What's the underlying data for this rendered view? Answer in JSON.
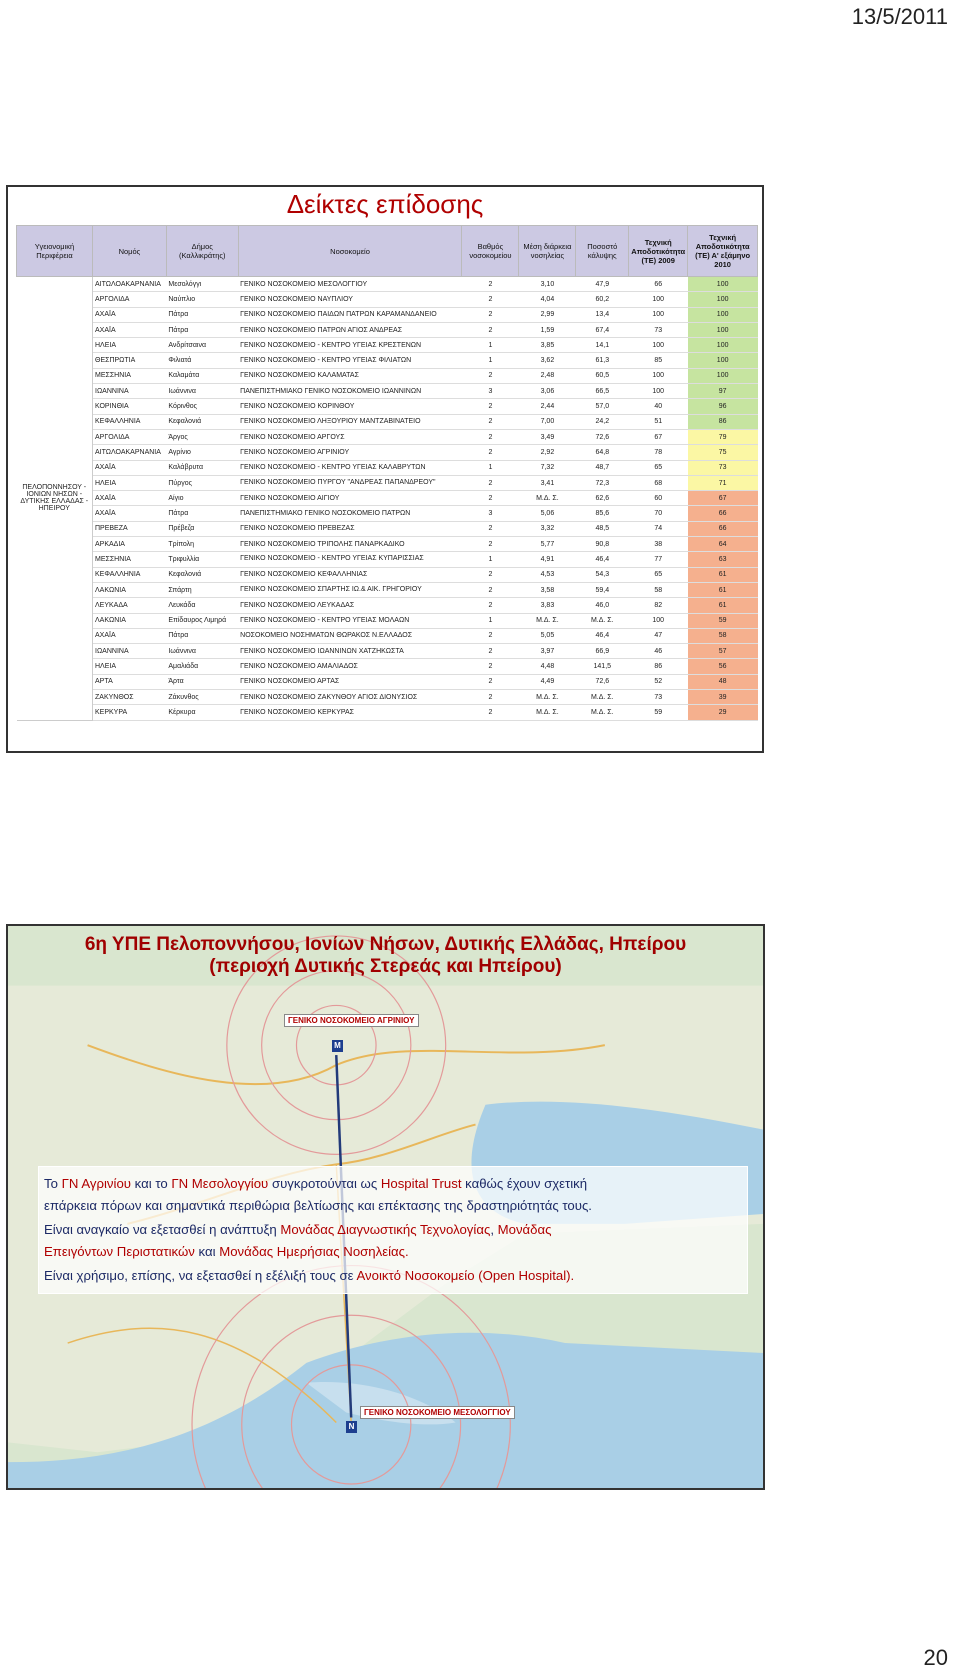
{
  "page": {
    "date": "13/5/2011",
    "page_number": "20"
  },
  "slide1": {
    "title": "Δείκτες επίδοσης",
    "headers": {
      "region": "Υγειονομική Περιφέρεια",
      "prefecture": "Νομός",
      "municipality": "Δήμος (Καλλικράτης)",
      "hospital": "Νοσοκομείο",
      "grade": "Βαθμός νοσοκομείου",
      "avg_stay": "Μέση διάρκεια νοσηλείας",
      "coverage": "Ποσοστό κάλυψης",
      "tech_2009": "Τεχνική Αποδοτικότητα (ΤΕ) 2009",
      "tech_2010": "Τεχνική Αποδοτικότητα (ΤΕ) Α' εξάμηνο 2010"
    },
    "region_name": "ΠΕΛΟΠΟΝΝΗΣΟΥ - ΙΟΝΙΩΝ ΝΗΣΩΝ - ΔΥΤΙΚΗΣ ΕΛΛΑΔΑΣ - ΗΠΕΙΡΟΥ",
    "rows": [
      {
        "prefecture": "ΑΙΤΩΛΟΑΚΑΡΝΑΝΙΑ",
        "municipality": "Μεσολόγγι",
        "hospital": "ΓΕΝΙΚΟ ΝΟΣΟΚΟΜΕΙΟ ΜΕΣΟΛΟΓΓΙΟΥ",
        "grade": "2",
        "stay": "3,10",
        "coverage": "47,9",
        "te2009": "66",
        "te2010": "100",
        "color": "g"
      },
      {
        "prefecture": "ΑΡΓΟΛΙΔΑ",
        "municipality": "Ναύπλιο",
        "hospital": "ΓΕΝΙΚΟ ΝΟΣΟΚΟΜΕΙΟ ΝΑΥΠΛΙΟΥ",
        "grade": "2",
        "stay": "4,04",
        "coverage": "60,2",
        "te2009": "100",
        "te2010": "100",
        "color": "g"
      },
      {
        "prefecture": "ΑΧΑΪΑ",
        "municipality": "Πάτρα",
        "hospital": "ΓΕΝΙΚΟ ΝΟΣΟΚΟΜΕΙΟ ΠΑΙΔΩΝ ΠΑΤΡΩΝ ΚΑΡΑΜΑΝΔΑΝΕΙΟ",
        "grade": "2",
        "stay": "2,99",
        "coverage": "13,4",
        "te2009": "100",
        "te2010": "100",
        "color": "g"
      },
      {
        "prefecture": "ΑΧΑΪΑ",
        "municipality": "Πάτρα",
        "hospital": "ΓΕΝΙΚΟ ΝΟΣΟΚΟΜΕΙΟ ΠΑΤΡΩΝ ΑΓΙΟΣ ΑΝΔΡΕΑΣ",
        "grade": "2",
        "stay": "1,59",
        "coverage": "67,4",
        "te2009": "73",
        "te2010": "100",
        "color": "g"
      },
      {
        "prefecture": "ΗΛΕΙΑ",
        "municipality": "Ανδρίτσαινα",
        "hospital": "ΓΕΝΙΚΟ ΝΟΣΟΚΟΜΕΙΟ - ΚΕΝΤΡΟ ΥΓΕΙΑΣ ΚΡΕΣΤΕΝΩΝ",
        "grade": "1",
        "stay": "3,85",
        "coverage": "14,1",
        "te2009": "100",
        "te2010": "100",
        "color": "g"
      },
      {
        "prefecture": "ΘΕΣΠΡΩΤΙΑ",
        "municipality": "Φιλιατά",
        "hospital": "ΓΕΝΙΚΟ ΝΟΣΟΚΟΜΕΙΟ - ΚΕΝΤΡΟ ΥΓΕΙΑΣ ΦΙΛΙΑΤΩΝ",
        "grade": "1",
        "stay": "3,62",
        "coverage": "61,3",
        "te2009": "85",
        "te2010": "100",
        "color": "g"
      },
      {
        "prefecture": "ΜΕΣΣΗΝΙΑ",
        "municipality": "Καλαμάτα",
        "hospital": "ΓΕΝΙΚΟ ΝΟΣΟΚΟΜΕΙΟ ΚΑΛΑΜΑΤΑΣ",
        "grade": "2",
        "stay": "2,48",
        "coverage": "60,5",
        "te2009": "100",
        "te2010": "100",
        "color": "g"
      },
      {
        "prefecture": "ΙΩΑΝΝΙΝΑ",
        "municipality": "Ιωάννινα",
        "hospital": "ΠΑΝΕΠΙΣΤΗΜΙΑΚΟ ΓΕΝΙΚΟ ΝΟΣΟΚΟΜΕΙΟ ΙΩΑΝΝΙΝΩΝ",
        "grade": "3",
        "stay": "3,06",
        "coverage": "66,5",
        "te2009": "100",
        "te2010": "97",
        "color": "g"
      },
      {
        "prefecture": "ΚΟΡΙΝΘΙΑ",
        "municipality": "Κόρινθος",
        "hospital": "ΓΕΝΙΚΟ ΝΟΣΟΚΟΜΕΙΟ ΚΟΡΙΝΘΟΥ",
        "grade": "2",
        "stay": "2,44",
        "coverage": "57,0",
        "te2009": "40",
        "te2010": "96",
        "color": "g"
      },
      {
        "prefecture": "ΚΕΦΑΛΛΗΝΙΑ",
        "municipality": "Κεφαλονιά",
        "hospital": "ΓΕΝΙΚΟ ΝΟΣΟΚΟΜΕΙΟ ΛΗΞΟΥΡΙΟΥ ΜΑΝΤΖΑΒΙΝΑΤΕΙΟ",
        "grade": "2",
        "stay": "7,00",
        "coverage": "24,2",
        "te2009": "51",
        "te2010": "86",
        "color": "g"
      },
      {
        "prefecture": "ΑΡΓΟΛΙΔΑ",
        "municipality": "Άργος",
        "hospital": "ΓΕΝΙΚΟ ΝΟΣΟΚΟΜΕΙΟ ΑΡΓΟΥΣ",
        "grade": "2",
        "stay": "3,49",
        "coverage": "72,6",
        "te2009": "67",
        "te2010": "79",
        "color": "y"
      },
      {
        "prefecture": "ΑΙΤΩΛΟΑΚΑΡΝΑΝΙΑ",
        "municipality": "Αγρίνιο",
        "hospital": "ΓΕΝΙΚΟ ΝΟΣΟΚΟΜΕΙΟ ΑΓΡΙΝΙΟΥ",
        "grade": "2",
        "stay": "2,92",
        "coverage": "64,8",
        "te2009": "78",
        "te2010": "75",
        "color": "y"
      },
      {
        "prefecture": "ΑΧΑΪΑ",
        "municipality": "Καλάβρυτα",
        "hospital": "ΓΕΝΙΚΟ ΝΟΣΟΚΟΜΕΙΟ - ΚΕΝΤΡΟ ΥΓΕΙΑΣ ΚΑΛΑΒΡΥΤΩΝ",
        "grade": "1",
        "stay": "7,32",
        "coverage": "48,7",
        "te2009": "65",
        "te2010": "73",
        "color": "y"
      },
      {
        "prefecture": "ΗΛΕΙΑ",
        "municipality": "Πύργος",
        "hospital": "ΓΕΝΙΚΟ ΝΟΣΟΚΟΜΕΙΟ ΠΥΡΓΟΥ \"ΑΝΔΡΕΑΣ ΠΑΠΑΝΔΡΕΟΥ\"",
        "grade": "2",
        "stay": "3,41",
        "coverage": "72,3",
        "te2009": "68",
        "te2010": "71",
        "color": "y"
      },
      {
        "prefecture": "ΑΧΑΪΑ",
        "municipality": "Αίγιο",
        "hospital": "ΓΕΝΙΚΟ ΝΟΣΟΚΟΜΕΙΟ ΑΙΓΙΟΥ",
        "grade": "2",
        "stay": "Μ.Δ. Σ.",
        "coverage": "62,6",
        "te2009": "60",
        "te2010": "67",
        "color": "o"
      },
      {
        "prefecture": "ΑΧΑΪΑ",
        "municipality": "Πάτρα",
        "hospital": "ΠΑΝΕΠΙΣΤΗΜΙΑΚΟ ΓΕΝΙΚΟ ΝΟΣΟΚΟΜΕΙΟ ΠΑΤΡΩΝ",
        "grade": "3",
        "stay": "5,06",
        "coverage": "85,6",
        "te2009": "70",
        "te2010": "66",
        "color": "o"
      },
      {
        "prefecture": "ΠΡΕΒΕΖΑ",
        "municipality": "Πρέβεζα",
        "hospital": "ΓΕΝΙΚΟ ΝΟΣΟΚΟΜΕΙΟ ΠΡΕΒΕΖΑΣ",
        "grade": "2",
        "stay": "3,32",
        "coverage": "48,5",
        "te2009": "74",
        "te2010": "66",
        "color": "o"
      },
      {
        "prefecture": "ΑΡΚΑΔΙΑ",
        "municipality": "Τρίπολη",
        "hospital": "ΓΕΝΙΚΟ ΝΟΣΟΚΟΜΕΙΟ ΤΡΙΠΟΛΗΣ ΠΑΝΑΡΚΑΔΙΚΟ",
        "grade": "2",
        "stay": "5,77",
        "coverage": "90,8",
        "te2009": "38",
        "te2010": "64",
        "color": "o"
      },
      {
        "prefecture": "ΜΕΣΣΗΝΙΑ",
        "municipality": "Τριφυλλία",
        "hospital": "ΓΕΝΙΚΟ ΝΟΣΟΚΟΜΕΙΟ - ΚΕΝΤΡΟ ΥΓΕΙΑΣ ΚΥΠΑΡΙΣΣΙΑΣ",
        "grade": "1",
        "stay": "4,91",
        "coverage": "46,4",
        "te2009": "77",
        "te2010": "63",
        "color": "o"
      },
      {
        "prefecture": "ΚΕΦΑΛΛΗΝΙΑ",
        "municipality": "Κεφαλονιά",
        "hospital": "ΓΕΝΙΚΟ ΝΟΣΟΚΟΜΕΙΟ ΚΕΦΑΛΛΗΝΙΑΣ",
        "grade": "2",
        "stay": "4,53",
        "coverage": "54,3",
        "te2009": "65",
        "te2010": "61",
        "color": "o"
      },
      {
        "prefecture": "ΛΑΚΩΝΙΑ",
        "municipality": "Σπάρτη",
        "hospital": "ΓΕΝΙΚΟ ΝΟΣΟΚΟΜΕΙΟ ΣΠΑΡΤΗΣ ΙΩ.& ΑΙΚ. ΓΡΗΓΟΡΙΟΥ",
        "grade": "2",
        "stay": "3,58",
        "coverage": "59,4",
        "te2009": "58",
        "te2010": "61",
        "color": "o"
      },
      {
        "prefecture": "ΛΕΥΚΑΔΑ",
        "municipality": "Λευκάδα",
        "hospital": "ΓΕΝΙΚΟ ΝΟΣΟΚΟΜΕΙΟ ΛΕΥΚΑΔΑΣ",
        "grade": "2",
        "stay": "3,83",
        "coverage": "46,0",
        "te2009": "82",
        "te2010": "61",
        "color": "o"
      },
      {
        "prefecture": "ΛΑΚΩΝΙΑ",
        "municipality": "Επίδαυρος Λιμηρά",
        "hospital": "ΓΕΝΙΚΟ ΝΟΣΟΚΟΜΕΙΟ - ΚΕΝΤΡΟ ΥΓΕΙΑΣ ΜΟΛΑΩΝ",
        "grade": "1",
        "stay": "Μ.Δ. Σ.",
        "coverage": "Μ.Δ. Σ.",
        "te2009": "100",
        "te2010": "59",
        "color": "o"
      },
      {
        "prefecture": "ΑΧΑΪΑ",
        "municipality": "Πάτρα",
        "hospital": "ΝΟΣΟΚΟΜΕΙΟ ΝΟΣΗΜΑΤΩΝ ΘΩΡΑΚΟΣ Ν.ΕΛΛΑΔΟΣ",
        "grade": "2",
        "stay": "5,05",
        "coverage": "46,4",
        "te2009": "47",
        "te2010": "58",
        "color": "o"
      },
      {
        "prefecture": "ΙΩΑΝΝΙΝΑ",
        "municipality": "Ιωάννινα",
        "hospital": "ΓΕΝΙΚΟ ΝΟΣΟΚΟΜΕΙΟ ΙΩΑΝΝΙΝΩΝ ΧΑΤΖΗΚΩΣΤΑ",
        "grade": "2",
        "stay": "3,97",
        "coverage": "66,9",
        "te2009": "46",
        "te2010": "57",
        "color": "o"
      },
      {
        "prefecture": "ΗΛΕΙΑ",
        "municipality": "Αμαλιάδα",
        "hospital": "ΓΕΝΙΚΟ ΝΟΣΟΚΟΜΕΙΟ ΑΜΑΛΙΑΔΟΣ",
        "grade": "2",
        "stay": "4,48",
        "coverage": "141,5",
        "te2009": "86",
        "te2010": "56",
        "color": "o"
      },
      {
        "prefecture": "ΑΡΤΑ",
        "municipality": "Άρτα",
        "hospital": "ΓΕΝΙΚΟ ΝΟΣΟΚΟΜΕΙΟ ΑΡΤΑΣ",
        "grade": "2",
        "stay": "4,49",
        "coverage": "72,6",
        "te2009": "52",
        "te2010": "48",
        "color": "o"
      },
      {
        "prefecture": "ΖΑΚΥΝΘΟΣ",
        "municipality": "Ζάκυνθος",
        "hospital": "ΓΕΝΙΚΟ ΝΟΣΟΚΟΜΕΙΟ ΖΑΚΥΝΘΟΥ ΑΓΙΟΣ ΔΙΟΝΥΣΙΟΣ",
        "grade": "2",
        "stay": "Μ.Δ. Σ.",
        "coverage": "Μ.Δ. Σ.",
        "te2009": "73",
        "te2010": "39",
        "color": "o"
      },
      {
        "prefecture": "ΚΕΡΚΥΡΑ",
        "municipality": "Κέρκυρα",
        "hospital": "ΓΕΝΙΚΟ ΝΟΣΟΚΟΜΕΙΟ ΚΕΡΚΥΡΑΣ",
        "grade": "2",
        "stay": "Μ.Δ. Σ.",
        "coverage": "Μ.Δ. Σ.",
        "te2009": "59",
        "te2010": "29",
        "color": "o"
      }
    ],
    "colors": {
      "g": "#c6e4a0",
      "y": "#fbf7a4",
      "o": "#f5b08e",
      "header": "#ccc9e3",
      "title": "#b00000"
    }
  },
  "slide2": {
    "title_line1": "6η ΥΠΕ Πελοποννήσου, Ιονίων Νήσων, Δυτικής Ελλάδας, Ηπείρου",
    "title_line2": "(περιοχή Δυτικής Στερεάς και Ηπείρου)",
    "map_labels": {
      "agrinio": "ΓΕΝΙΚΟ ΝΟΣΟΚΟΜΕΙΟ ΑΓΡΙΝΙΟΥ",
      "mesolongi": "ΓΕΝΙΚΟ ΝΟΣΟΚΟΜΕΙΟ ΜΕΣΟΛΟΓΓΙΟΥ",
      "pin_m": "M",
      "pin_n": "N"
    },
    "text": {
      "l1_a": "Το ",
      "l1_b": "ΓΝ Αγρινίου",
      "l1_c": " και το ",
      "l1_d": "ΓΝ Μεσολογγίου",
      "l1_e": " συγκροτούνται ως ",
      "l1_f": "Hospital Trust",
      "l1_g": " καθώς έχουν σχετική",
      "l2": "επάρκεια πόρων και σημαντικά περιθώρια βελτίωσης και επέκτασης της δραστηριότητάς τους.",
      "l3_a": "Είναι αναγκαίο να εξετασθεί η ανάπτυξη ",
      "l3_b": "Μονάδας Διαγνωστικής Τεχνολογίας",
      "l3_c": ", ",
      "l3_d": "Μονάδας",
      "l4_a": "Επειγόντων Περιστατικών",
      "l4_b": " και ",
      "l4_c": "Μονάδας Ημερήσιας Νοσηλείας.",
      "l5_a": "Είναι χρήσιμο, επίσης, να εξετασθεί η εξέλιξή τους σε ",
      "l5_b": "Ανοικτό Νοσοκομείο (Open Hospital)."
    }
  }
}
